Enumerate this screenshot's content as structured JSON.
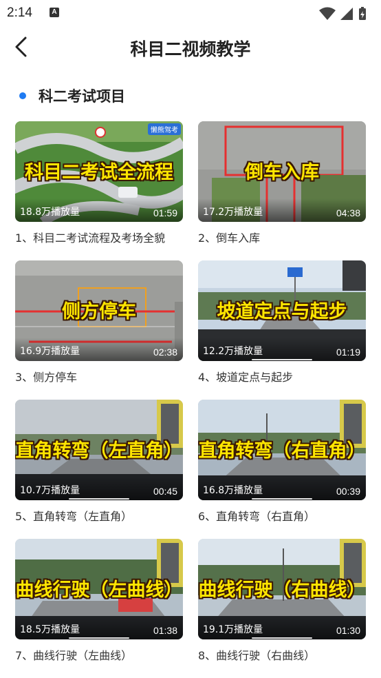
{
  "status_bar": {
    "time": "2:14",
    "notification_icon": "A"
  },
  "header": {
    "title": "科目二视频教学"
  },
  "section": {
    "title": "科二考试项目"
  },
  "videos": [
    {
      "overlay_title": "科目二考试全流程",
      "plays": "18.8万播放量",
      "duration": "01:59",
      "caption": "1、科目二考试流程及考场全貌",
      "badge": "懒熊驾考"
    },
    {
      "overlay_title": "倒车入库",
      "plays": "17.2万播放量",
      "duration": "04:38",
      "caption": "2、倒车入库"
    },
    {
      "overlay_title": "侧方停车",
      "plays": "16.9万播放量",
      "duration": "02:38",
      "caption": "3、侧方停车"
    },
    {
      "overlay_title": "坡道定点与起步",
      "plays": "12.2万播放量",
      "duration": "01:19",
      "caption": "4、坡道定点与起步"
    },
    {
      "overlay_title": "直角转弯（左直角）",
      "plays": "10.7万播放量",
      "duration": "00:45",
      "caption": "5、直角转弯（左直角）"
    },
    {
      "overlay_title": "直角转弯（右直角）",
      "plays": "16.8万播放量",
      "duration": "00:39",
      "caption": "6、直角转弯（右直角）"
    },
    {
      "overlay_title": "曲线行驶（左曲线）",
      "plays": "18.5万播放量",
      "duration": "01:38",
      "caption": "7、曲线行驶（左曲线）"
    },
    {
      "overlay_title": "曲线行驶（右曲线）",
      "plays": "19.1万播放量",
      "duration": "01:30",
      "caption": "8、曲线行驶（右曲线）"
    }
  ],
  "colors": {
    "accent": "#1f7bf2",
    "overlay_text": "#ffe600"
  },
  "icons": {
    "back": "chevron-left-icon",
    "wifi": "wifi-icon",
    "signal": "signal-icon",
    "battery": "battery-icon"
  }
}
